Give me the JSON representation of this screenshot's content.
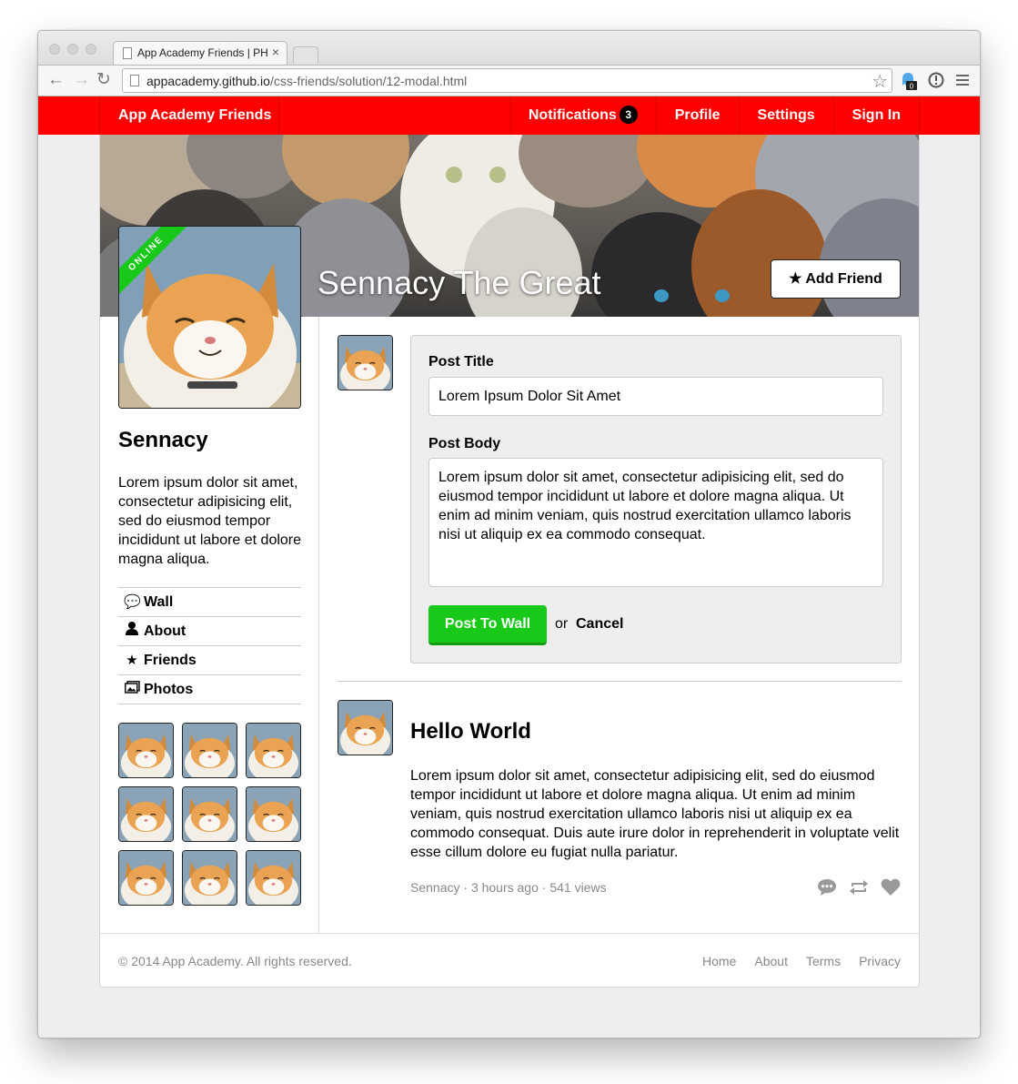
{
  "browser": {
    "tab_title": "App Academy Friends | PH",
    "tab_close": "×",
    "url_host": "appacademy.github.io",
    "url_path": "/css-friends/solution/12-modal.html",
    "ext_badge": "0"
  },
  "nav": {
    "brand": "App Academy Friends",
    "notifications": "Notifications",
    "notifications_count": "3",
    "profile": "Profile",
    "settings": "Settings",
    "sign_in": "Sign In"
  },
  "cover": {
    "name": "Sennacy The Great",
    "add_friend": "Add Friend"
  },
  "profile": {
    "status": "ONLINE",
    "name": "Sennacy",
    "bio": "Lorem ipsum dolor sit amet, consectetur adipisicing elit, sed do eiusmod tempor incididunt ut labore et dolore magna aliqua."
  },
  "sidebar_nav": [
    "Wall",
    "About",
    "Friends",
    "Photos"
  ],
  "form": {
    "title_label": "Post Title",
    "title_value": "Lorem Ipsum Dolor Sit Amet",
    "body_label": "Post Body",
    "body_value": "Lorem ipsum dolor sit amet, consectetur adipisicing elit, sed do eiusmod tempor incididunt ut labore et dolore magna aliqua. Ut enim ad minim veniam, quis nostrud exercitation ullamco laboris nisi ut aliquip ex ea commodo consequat.",
    "submit": "Post To Wall",
    "or": "or",
    "cancel": "Cancel"
  },
  "post": {
    "title": "Hello World",
    "body": "Lorem ipsum dolor sit amet, consectetur adipisicing elit, sed do eiusmod tempor incididunt ut labore et dolore magna aliqua. Ut enim ad minim veniam, quis nostrud exercitation ullamco laboris nisi ut aliquip ex ea commodo consequat. Duis aute irure dolor in reprehenderit in voluptate velit esse cillum dolore eu fugiat nulla pariatur.",
    "author": "Sennacy",
    "time": "3 hours ago",
    "views": "541 views",
    "sep": "·"
  },
  "footer": {
    "copyright": "© 2014 App Academy. All rights reserved.",
    "links": [
      "Home",
      "About",
      "Terms",
      "Privacy"
    ]
  },
  "colors": {
    "nav_bg": "#ff0000",
    "online_green": "#19c919",
    "button_green": "#19c919",
    "muted_text": "#888888"
  },
  "icons": [
    "back-arrow-icon",
    "forward-arrow-icon",
    "reload-icon",
    "page-icon",
    "bookmark-star-icon",
    "ghost-extension-icon",
    "info-extension-icon",
    "menu-icon",
    "star-icon",
    "comment-icon",
    "user-icon",
    "photos-icon",
    "repost-icon",
    "heart-icon"
  ]
}
